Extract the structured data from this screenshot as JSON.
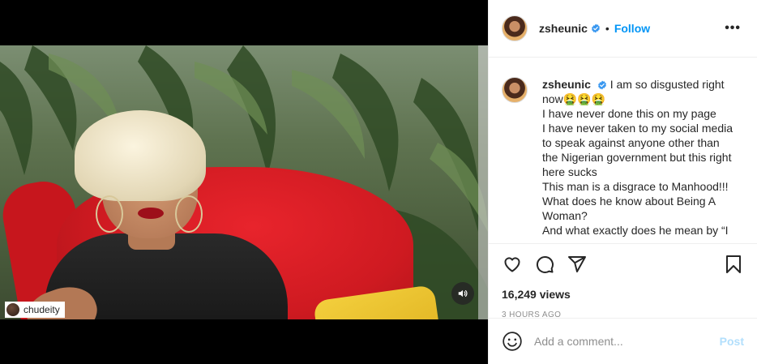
{
  "post": {
    "username": "zsheunic",
    "separator": "•",
    "follow_label": "Follow",
    "more_label": "•••",
    "caption_lines": [
      "I am so disgusted right now🤮🤮🤮",
      "I have never done this on my page",
      "I have never taken to my social media to speak against anyone other than the Nigerian government but this right here sucks",
      "This man is a disgrace to Manhood!!!",
      "What does he know about Being A Woman?",
      "And what exactly does he mean by “I"
    ],
    "views": "16,249 views",
    "timestamp": "3 HOURS AGO"
  },
  "media": {
    "credit_user": "chudeity"
  },
  "comment": {
    "placeholder": "Add a comment...",
    "post_label": "Post"
  },
  "colors": {
    "accent": "#0095f6",
    "post_disabled": "#b2dffc",
    "muted": "#8e8e8e"
  },
  "icons": [
    "verified-badge-icon",
    "heart-icon",
    "comment-icon",
    "share-icon",
    "bookmark-icon",
    "volume-icon",
    "emoji-icon",
    "more-options-icon"
  ]
}
